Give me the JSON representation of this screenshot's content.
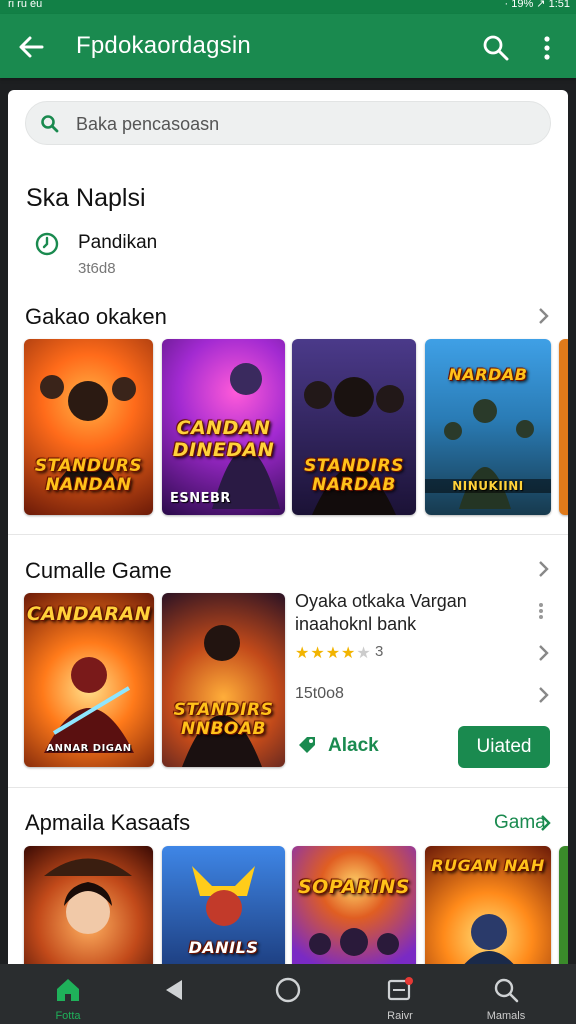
{
  "status_bar": {
    "left": "ri ru èu",
    "right": "· 19% ↗ 1:51"
  },
  "app_bar": {
    "title": "Fpdokaordagsin"
  },
  "search": {
    "placeholder": "Baka pencasoasn"
  },
  "recommended": {
    "title": "Ska Naplsi",
    "item_name": "Pandikan",
    "item_sub": "3t6d8"
  },
  "section1": {
    "title": "Gakao okaken",
    "tiles": [
      {
        "caption": "STANDURS NANDAN",
        "colors": [
          "#ff8a1c",
          "#7a1a08"
        ]
      },
      {
        "caption": "CANDAN DINEDAN",
        "footer": "ESNEBR",
        "colors": [
          "#b02ad1",
          "#3a0c5a"
        ]
      },
      {
        "caption": "STANDIRS NARDAB",
        "colors": [
          "#3b2a6e",
          "#13102a"
        ]
      },
      {
        "caption": "NARDAB",
        "footer": "NINUKIINI",
        "colors": [
          "#2f8fd6",
          "#0f3b5a"
        ]
      }
    ]
  },
  "section2": {
    "title": "Cumalle Game",
    "game_name": "Oyaka otkaka Vargan inaahoknl bank",
    "rating_value": "3",
    "downloads": "15t0o8",
    "tag": "Alack",
    "button": "Uiated",
    "tiles": [
      {
        "caption": "CANDARAN",
        "footer": "ANNAR DIGAN",
        "colors": [
          "#ff7a1a",
          "#7a2a0a"
        ]
      },
      {
        "caption": "STANDIRS NNBOAB",
        "colors": [
          "#4b2050",
          "#d95a17"
        ]
      }
    ]
  },
  "section3": {
    "title": "Apmaila Kasaafs",
    "link": "Gama",
    "tiles": [
      {
        "caption": "",
        "colors": [
          "#e0641c",
          "#5a1208"
        ]
      },
      {
        "caption": "DANILS",
        "colors": [
          "#2a64c8",
          "#0b1f4a"
        ]
      },
      {
        "caption": "SOPARINS",
        "colors": [
          "#8d2ec4",
          "#e05e22"
        ]
      },
      {
        "caption": "RUGAN NAH",
        "colors": [
          "#ff9d1f",
          "#7a2a0a"
        ]
      }
    ]
  },
  "nav": {
    "items": [
      {
        "label": "Fotta"
      },
      {
        "label": ""
      },
      {
        "label": ""
      },
      {
        "label": "Raivr"
      },
      {
        "label": "Mamals"
      }
    ]
  },
  "colors": {
    "brand": "#1a8a4f",
    "star": "#f2b400",
    "badge": "#e53935"
  }
}
